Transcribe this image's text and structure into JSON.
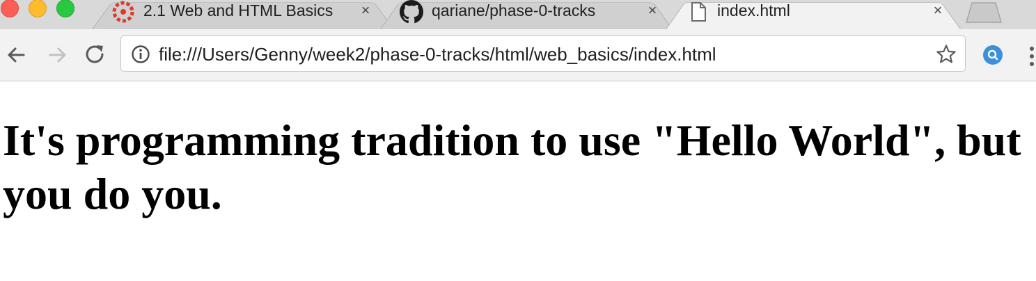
{
  "browser": {
    "tabs": [
      {
        "title": "2.1 Web and HTML Basics",
        "icon": "canvas-logo-icon",
        "active": false
      },
      {
        "title": "qariane/phase-0-tracks",
        "icon": "github-icon",
        "active": false
      },
      {
        "title": "index.html",
        "icon": "document-icon",
        "active": true
      }
    ],
    "tab_close_glyph": "×",
    "address_bar": {
      "url": "file:///Users/Genny/week2/phase-0-tracks/html/web_basics/index.html"
    }
  },
  "page": {
    "heading": "It's programming tradition to use \"Hello World\", but you do you."
  }
}
